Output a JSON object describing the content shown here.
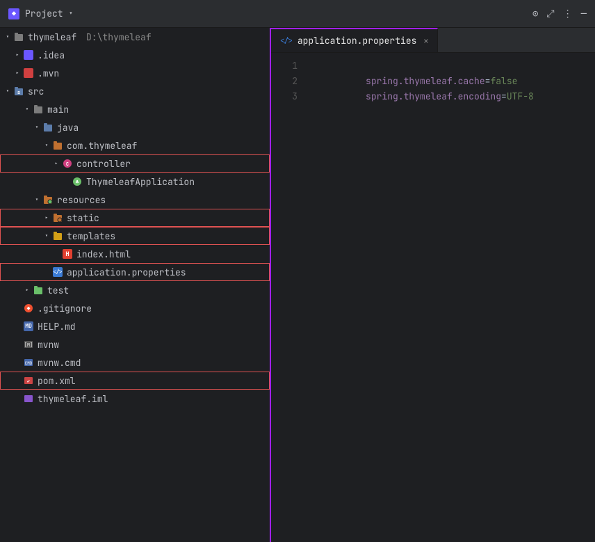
{
  "titleBar": {
    "projectIcon": "◆",
    "projectLabel": "Project",
    "projectArrow": "▾",
    "controls": [
      "⊙",
      "⤢",
      "⋮",
      "—"
    ]
  },
  "sidebar": {
    "rootLabel": "thymeleaf",
    "rootPath": "D:\\thymeleaf",
    "items": [
      {
        "id": "idea",
        "label": ".idea",
        "indent": 1,
        "arrow": "closed",
        "iconType": "idea",
        "highlighted": false
      },
      {
        "id": "mvn",
        "label": ".mvn",
        "indent": 1,
        "arrow": "closed",
        "iconType": "mvn",
        "highlighted": false
      },
      {
        "id": "src",
        "label": "src",
        "indent": 1,
        "arrow": "open",
        "iconType": "src",
        "highlighted": false
      },
      {
        "id": "main",
        "label": "main",
        "indent": 2,
        "arrow": "open",
        "iconType": "folder-plain",
        "highlighted": false
      },
      {
        "id": "java",
        "label": "java",
        "indent": 3,
        "arrow": "open",
        "iconType": "java-folder",
        "highlighted": false
      },
      {
        "id": "com-thymeleaf",
        "label": "com.thymeleaf",
        "indent": 4,
        "arrow": "open",
        "iconType": "package",
        "highlighted": false
      },
      {
        "id": "controller",
        "label": "controller",
        "indent": 5,
        "arrow": "closed",
        "iconType": "controller",
        "highlighted": true
      },
      {
        "id": "ThymeleafApplication",
        "label": "ThymeleafApplication",
        "indent": 5,
        "arrow": "none",
        "iconType": "spring",
        "highlighted": false
      },
      {
        "id": "resources",
        "label": "resources",
        "indent": 3,
        "arrow": "open",
        "iconType": "resources",
        "highlighted": false
      },
      {
        "id": "static",
        "label": "static",
        "indent": 4,
        "arrow": "closed",
        "iconType": "static-folder",
        "highlighted": true
      },
      {
        "id": "templates",
        "label": "templates",
        "indent": 4,
        "arrow": "open",
        "iconType": "templates-folder",
        "highlighted": true
      },
      {
        "id": "index.html",
        "label": "index.html",
        "indent": 5,
        "arrow": "none",
        "iconType": "html",
        "highlighted": false
      },
      {
        "id": "application.properties",
        "label": "application.properties",
        "indent": 4,
        "arrow": "none",
        "iconType": "properties",
        "highlighted": true
      },
      {
        "id": "test",
        "label": "test",
        "indent": 2,
        "arrow": "closed",
        "iconType": "test-folder",
        "highlighted": false
      },
      {
        "id": "gitignore",
        "label": ".gitignore",
        "indent": 1,
        "arrow": "none",
        "iconType": "gitignore",
        "highlighted": false
      },
      {
        "id": "HELP.md",
        "label": "HELP.md",
        "indent": 1,
        "arrow": "none",
        "iconType": "md",
        "highlighted": false
      },
      {
        "id": "mvnw",
        "label": "mvnw",
        "indent": 1,
        "arrow": "none",
        "iconType": "mvnw",
        "highlighted": false
      },
      {
        "id": "mvnw.cmd",
        "label": "mvnw.cmd",
        "indent": 1,
        "arrow": "none",
        "iconType": "cmd",
        "highlighted": false
      },
      {
        "id": "pom.xml",
        "label": "pom.xml",
        "indent": 1,
        "arrow": "none",
        "iconType": "pom",
        "highlighted": true
      },
      {
        "id": "thymeleaf.iml",
        "label": "thymeleaf.iml",
        "indent": 1,
        "arrow": "none",
        "iconType": "iml",
        "highlighted": false
      }
    ]
  },
  "editor": {
    "tabs": [
      {
        "id": "application-properties",
        "name": "application.properties",
        "iconType": "properties",
        "active": true,
        "closable": true
      }
    ],
    "lines": [
      {
        "num": 1,
        "content": "spring.thymeleaf.cache=false"
      },
      {
        "num": 2,
        "content": "spring.thymeleaf.encoding=UTF-8"
      },
      {
        "num": 3,
        "content": ""
      }
    ]
  }
}
